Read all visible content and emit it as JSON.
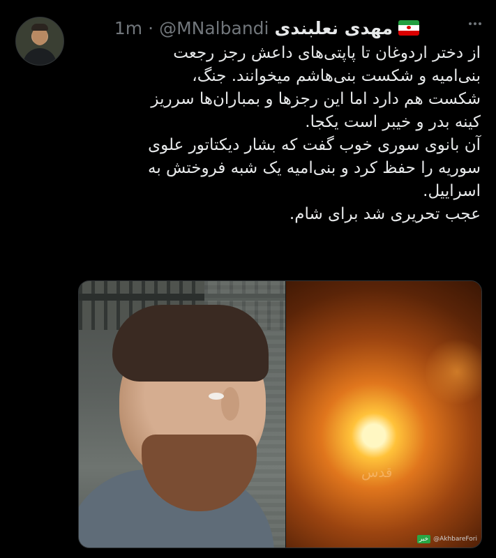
{
  "tweet": {
    "author": {
      "name": "مهدی نعلبندی",
      "handle": "@MNalbandi",
      "separator": "·",
      "time": "1m"
    },
    "text_lines": [
      "از دختر اردوغان تا پاپتی‌های داعش رجز رجعت",
      "بنی‌امیه و شکست بنی‌هاشم میخوانند. جنگ،",
      "شکست هم دارد اما این رجزها و بمباران‌ها سرریز",
      "کینه بدر و خیبر است یکجا.",
      "آن بانوی سوری خوب گفت که بشار دیکتاتور علوی",
      "سوریه را حفظ کرد و بنی‌امیه یک شبه فروختش به",
      "اسراییل.",
      "عجب تحریری شد برای شام."
    ],
    "media": {
      "watermark": "قدس",
      "credit_logo": "خبر",
      "credit_handle": "@AkhbareFori"
    }
  },
  "icons": {
    "flag": "iran-flag-icon",
    "more": "more-options-icon"
  },
  "colors": {
    "background": "#000000",
    "text": "#e7e9ea",
    "secondary": "#71767b"
  }
}
